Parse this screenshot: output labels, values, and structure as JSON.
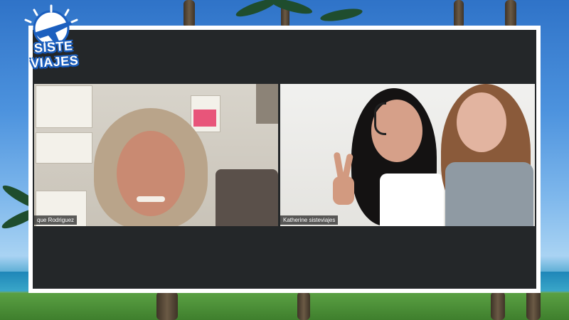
{
  "brand": {
    "logo_text": "SISTE VIAJES",
    "primary_color": "#1b5fbf"
  },
  "meeting": {
    "participants": [
      {
        "name_label": "que Rodriguez"
      },
      {
        "name_label": "Katherine sisteviajes"
      }
    ]
  }
}
